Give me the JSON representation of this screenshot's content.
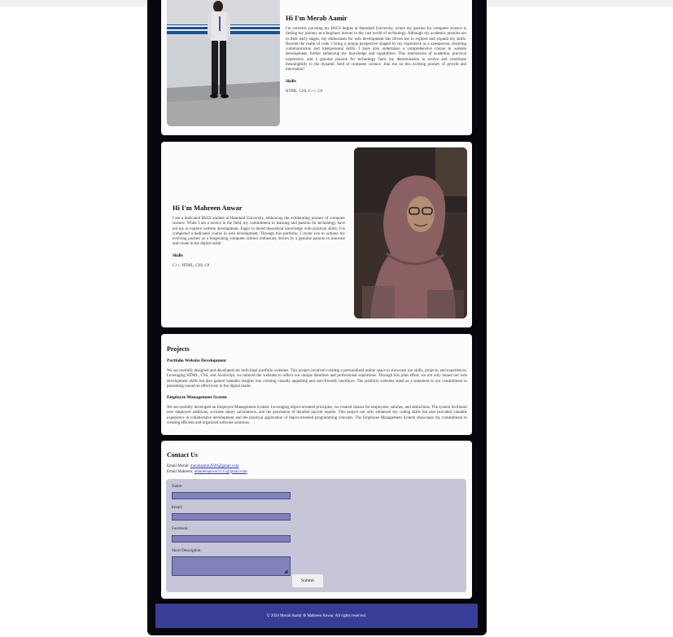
{
  "about_merab": {
    "heading": "Hi I'm Merab Aamir",
    "bio": "I'm currently pursuing my BSCS degree at Hamdard University, where my passion for computer science is fueling my journey as a beginner learner in the vast world of technology. Although my academic pursuits are in their early stages, my enthusiasm for web development has driven me to explore and expand my skills. Beyond the realm of code, I bring a unique perspective shaped by my experience as a salesperson, fostering communication and interpersonal skills. I have also undertaken a comprehensive course in website development, further enhancing my knowledge and capabilities. This intersection of academia, practical experience, and a genuine passion for technology fuels my determination to evolve and contribute meaningfully to the dynamic field of computer science. Join me on this exciting journey of growth and innovation!",
    "skills_heading": "Skills",
    "skills": "HTML, CSS, C++, C#"
  },
  "about_mahreen": {
    "heading": "Hi I'm Mahreen Anwar",
    "bio": "I am a dedicated BSCS student at Hamdard University, embracing the exhilarating journey of computer science. While I am a novice in the field, my commitment to learning and passion for technology have led me to explore website development. Eager to blend theoretical knowledge with practical skills, I've completed a dedicated course in web development. Through this portfolio, I invite you to witness my evolving journey as a burgeoning computer science enthusiast, driven by a genuine passion to innovate and create in the digital realm.",
    "skills_heading": "Skills",
    "skills": "C++, HTML, CSS, C#"
  },
  "projects": {
    "heading": "Projects",
    "items": [
      {
        "title": "Portfolio Website Development",
        "description": "We successfully designed and developed our individual portfolio websites. This project involved creating a personalized online space to showcase our skills, projects, and experiences. Leveraging HTML, CSS, and JavaScript, we tailored the websites to reflect our unique identities and professional aspirations. Through this joint effort, we not only honed our web development skills but also gained valuable insights into creating visually appealing and user-friendly interfaces. The portfolio websites stand as a testament to our commitment to presenting ourselves effectively in the digital realm."
      },
      {
        "title": "Employee Management System",
        "description": "We successfully developed an Employee Management System. Leveraging object-oriented principles, we created classes for employees, salaries, and deductions. The system facilitates new employee additions, accurate salary calculations, and the generation of detailed payroll reports. This project not only enhanced my coding skills but also provided valuable experience in collaborative development and the practical application of object-oriented programming concepts. The Employee Management System showcases my commitment to creating efficient and organized software solutions."
      }
    ]
  },
  "contact": {
    "heading": "Contact Us",
    "email_merab_label": "Email Merab:",
    "email_merab": "merabaamir2828@gmail.com",
    "email_mahreen_label": "Email Mahreen:",
    "email_mahreen": "mahreenanwar2115@gmail.com",
    "form": {
      "name_label": "Name:",
      "email_label": "Email:",
      "facebook_label": "Facebook:",
      "description_label": "Short Description:",
      "submit_label": "Submit"
    }
  },
  "footer": {
    "text": "© 2024 Merab Aamir & Mahreen Anwar. All rights reserved."
  },
  "colors": {
    "frame": "#06060c",
    "card": "#fcfcfd",
    "form_bg": "#c6c6d8",
    "input_bg": "#8081bd",
    "footer_bg": "#3a3d96",
    "link": "#2b2bd6"
  },
  "icons": {
    "photo_merab": "person-photo-standing",
    "photo_mahreen": "person-photo-hijab",
    "resize_grip": "resize-grip-icon"
  }
}
